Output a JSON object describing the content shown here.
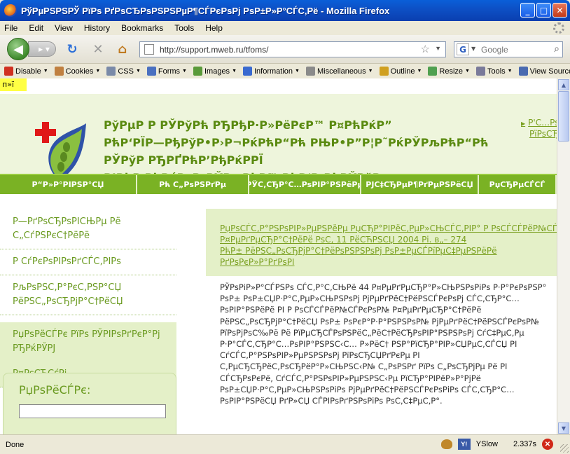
{
  "window": {
    "title": "РўРµРЅРЅРЎ РїРѕ РґРѕСЂРѕРЅРЅРµР¶СЃРєРѕРј РѕР±Р»Р°СЃС‚Рё - Mozilla Firefox",
    "min_label": "_",
    "max_label": "□",
    "close_label": "✕"
  },
  "menu": [
    "File",
    "Edit",
    "View",
    "History",
    "Bookmarks",
    "Tools",
    "Help"
  ],
  "nav": {
    "url": "http://support.mweb.ru/tfoms/",
    "search_placeholder": "Google",
    "search_engine_letter": "G"
  },
  "devbar": {
    "items": [
      {
        "label": "Disable",
        "color": "#d03020"
      },
      {
        "label": "Cookies",
        "color": "#c08040"
      },
      {
        "label": "CSS",
        "color": "#7a8aa8"
      },
      {
        "label": "Forms",
        "color": "#4a70c0"
      },
      {
        "label": "Images",
        "color": "#5a9a3a"
      },
      {
        "label": "Information",
        "color": "#3a6ad0"
      },
      {
        "label": "Miscellaneous",
        "color": "#8a8a8a"
      },
      {
        "label": "Outline",
        "color": "#d0a020"
      },
      {
        "label": "Resize",
        "color": "#50a050"
      },
      {
        "label": "Tools",
        "color": "#7a7a9a"
      },
      {
        "label": "View Source",
        "color": "#4a6ab0"
      }
    ]
  },
  "page": {
    "badge": "п»ї",
    "org_name_lines": [
      "РўРµР Р РЎРўРћ РЂРђР·Р»РёРєР™ Р¤РћРќР”",
      "РћР‘РЇР—РђРўР•Р›Р¬РќРћР“Рћ РЊР•Р”Р¦Р˜РќРЎРљРћР“Рћ",
      "РЎРўР РЂРҐРћР’РђРќРРЇ",
      "Р’РћР РћРќР•Р–РЎРљРћР™ РћР‘Р›РђРЎРўР"
    ],
    "header_link_lines": [
      "Р'С…РѕРґ",
      "РїРѕСЂС‚Р°Р»"
    ],
    "nav_tabs": [
      {
        "label": "Р“Р»Р°РІРЅР°СЏ",
        "width": 196
      },
      {
        "label": "Рћ С„РѕРЅРґРµ",
        "width": 160
      },
      {
        "label": "РЎС‚СЂР°С…РѕРІР°РЅРёРµ",
        "width": 160
      },
      {
        "label": "РЈС‡СЂРµР¶РґРµРЅРёСЏ",
        "width": 168
      },
      {
        "label": "РџСЂРµСЃСЃ",
        "width": 111
      }
    ],
    "sidebar": [
      {
        "label": "Р—РґРѕСЂРѕРІСЊРµ Рё С„СѓРЅРєС†РёРё",
        "kind": "normal"
      },
      {
        "label": "Р СѓРєРѕРІРѕРґСЃС‚РІРѕ",
        "kind": "normal"
      },
      {
        "label": "РљРѕРЅС‚Р°РєС‚РЅР°СЏ РёРЅС„РѕСЂРјР°С†РёСЏ",
        "kind": "gap"
      },
      {
        "label": "РџРѕРёСЃРє РїРѕ РЎРІРѕРґРєР°Рј РЂРќРЎРЈ",
        "kind": "active"
      },
      {
        "label": "Р¤РѕСЂСѓРј",
        "kind": "plain"
      }
    ],
    "search_label": "РџРѕРёСЃРє:",
    "main_links": [
      "РџРѕСЃС‚Р°РЅРѕРІР»РµРЅРёРµ РџСЂР°РІРёС‚РµР»СЊСЃС‚РІР° Р РѕСЃСЃРёР№СЃРєРѕР№",
      "Р¤РµРґРµСЂР°С†РёРё РѕС‚ 11 РёСЋРЅСЏ 2004 Рі. в„– 274",
      "РћР± РёРЅС„РѕСЂРјР°С†РёРѕРЅРЅРѕРј РѕР±РµСЃРїРµС‡РµРЅРёРё",
      "РґРѕРєР»Р°РґРѕРІ"
    ],
    "main_text": "РЎРѕРіР»Р°СЃРЅРѕ СЃС‚Р°С‚СЊРё 44 Р¤РµРґРµСЂР°Р»СЊРЅРѕРіРѕ Р·Р°РєРѕРЅР° РѕР± РѕР±СЏР·Р°С‚РµР»СЊРЅРѕРј РјРµРґРёС†РёРЅСЃРєРѕРј СЃС‚СЂР°С…РѕРІР°РЅРёРё РІ Р РѕСЃСЃРёР№СЃРєРѕР№ Р¤РµРґРµСЂР°С†РёРё РёРЅС„РѕСЂРјР°С†РёСЏ РѕР± РѕРєР°Р·Р°РЅРЅРѕР№ РјРµРґРёС†РёРЅСЃРєРѕР№ РїРѕРјРѕС‰Рё Рё РїРµСЂСЃРѕРЅРёС„РёС†РёСЂРѕРІР°РЅРЅРѕРј СѓС‡РµС‚Рµ Р·Р°СЃС‚СЂР°С…РѕРІР°РЅРЅС‹С… Р»РёС† РЅР°РїСЂР°РІР»СЏРµС‚СЃСЏ РІ СѓСЃС‚Р°РЅРѕРІР»РµРЅРЅРѕРј РїРѕСЂСЏРґРєРµ РІ С‚РµСЂСЂРёС‚РѕСЂРёР°Р»СЊРЅС‹Р№ С„РѕРЅРґ РїРѕ С„РѕСЂРјРµ Рё РІ СЃСЂРѕРєРё, СѓСЃС‚Р°РЅРѕРІР»РµРЅРЅС‹Рµ РїСЂР°РІРёР»Р°РјРё РѕР±СЏР·Р°С‚РµР»СЊРЅРѕРіРѕ РјРµРґРёС†РёРЅСЃРєРѕРіРѕ СЃС‚СЂР°С…РѕРІР°РЅРёСЏ РґР»СЏ СЃРІРѕРґРЅРѕРіРѕ РѕС‚С‡РµС‚Р°."
  },
  "status": {
    "text": "Done",
    "yslow_label": "YSlow",
    "yslow_icon_text": "Y!",
    "error_icon_text": "✕",
    "time": "2.337s"
  }
}
